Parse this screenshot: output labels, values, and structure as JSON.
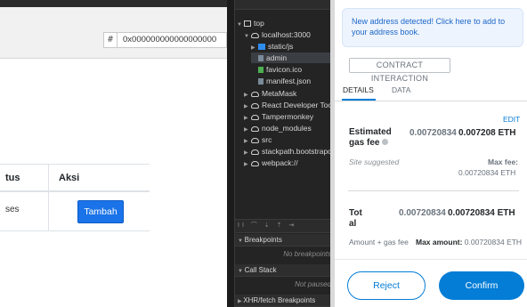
{
  "app": {
    "hash_symbol": "#",
    "address_value": "0x000000000000000000",
    "table": {
      "headers": [
        "tus",
        "Aksi"
      ],
      "row": {
        "status": "ses",
        "action_label": "Tambah"
      }
    }
  },
  "devtools": {
    "tree": [
      {
        "label": "top",
        "icon": "frame-icon",
        "expanded": true
      },
      {
        "label": "localhost:3000",
        "icon": "cloud-icon",
        "expanded": true
      },
      {
        "label": "static/js",
        "icon": "folder-icon",
        "expanded": false
      },
      {
        "label": "admin",
        "icon": "file-icon",
        "selected": true
      },
      {
        "label": "favicon.ico",
        "icon": "file-icon"
      },
      {
        "label": "manifest.json",
        "icon": "file-icon"
      },
      {
        "label": "MetaMask",
        "icon": "cloud-icon"
      },
      {
        "label": "React Developer Tool",
        "icon": "cloud-icon"
      },
      {
        "label": "Tampermonkey",
        "icon": "cloud-icon"
      },
      {
        "label": "node_modules",
        "icon": "cloud-icon"
      },
      {
        "label": "src",
        "icon": "cloud-icon"
      },
      {
        "label": "stackpath.bootstrapc",
        "icon": "cloud-icon"
      },
      {
        "label": "webpack://",
        "icon": "cloud-icon"
      }
    ],
    "toolbar_glyphs": "II ⌒ ⇣ ⇡ ⇥",
    "sections": {
      "breakpoints": {
        "title": "Breakpoints",
        "body": "No breakpoints"
      },
      "call_stack": {
        "title": "Call Stack",
        "body": "Not paused"
      },
      "xhr": {
        "title": "XHR/fetch Breakpoints"
      }
    }
  },
  "metamask": {
    "banner": "New address detected! Click here to add to your address book.",
    "contract_label": "CONTRACT INTERACTION",
    "tabs": {
      "details": "DETAILS",
      "data": "DATA"
    },
    "edit": "EDIT",
    "gas": {
      "label_line1": "Estimated",
      "label_line2": "gas fee",
      "value_grey": "0.00720834",
      "value_eth": "0.007208 ETH",
      "site_suggested": "Site suggested",
      "max_fee_label": "Max fee:",
      "max_fee_value": "0.00720834 ETH"
    },
    "total": {
      "label_line1": "Tot",
      "label_line2": "al",
      "value_grey": "0.00720834",
      "value_eth": "0.00720834 ETH",
      "amount_label": "Amount + gas fee",
      "max_amount_label": "Max amount:",
      "max_amount_value": "0.00720834 ETH"
    },
    "buttons": {
      "reject": "Reject",
      "confirm": "Confirm"
    },
    "colors": {
      "accent": "#037dd6",
      "banner_bg": "#eef4fd"
    }
  }
}
